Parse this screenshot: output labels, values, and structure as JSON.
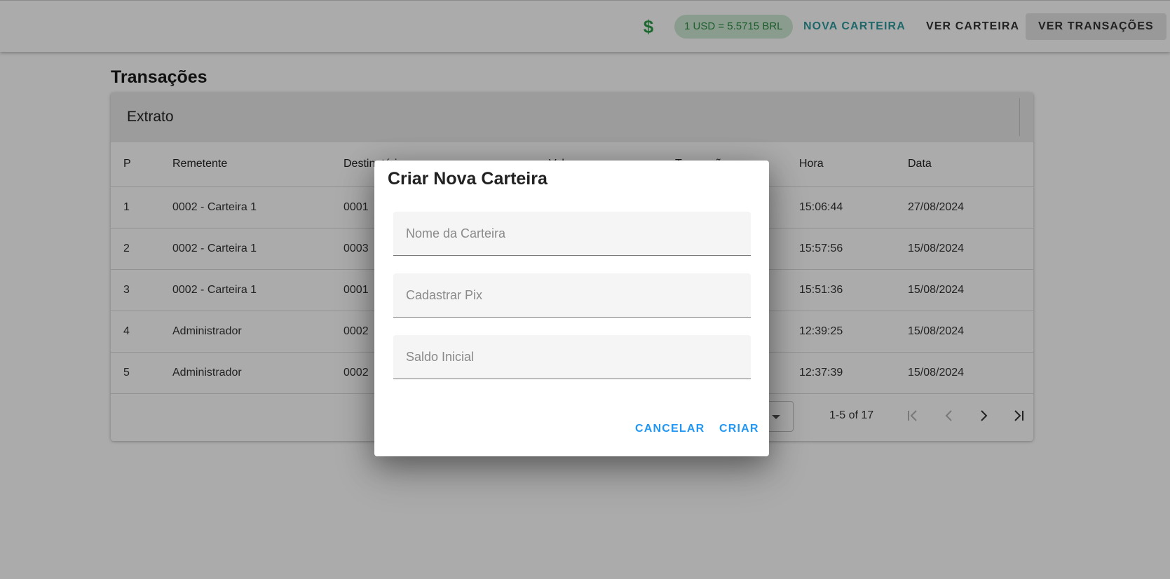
{
  "appbar": {
    "currency_icon": "dollar-icon",
    "exchange_rate": "1 USD = 5.5715 BRL",
    "nav": {
      "new_wallet": "NOVA CARTEIRA",
      "view_wallet": "VER CARTEIRA",
      "view_transactions": "VER TRANSAÇÕES"
    }
  },
  "page": {
    "title": "Transações",
    "card_title": "Extrato",
    "table": {
      "headers": [
        "P",
        "Remetente",
        "Destinatário",
        "Valor",
        "Transação",
        "Hora",
        "Data"
      ],
      "rows": [
        {
          "p": "1",
          "sender": "0002 - Carteira 1",
          "receiver": "0001",
          "hora": "15:06:44",
          "data": "27/08/2024"
        },
        {
          "p": "2",
          "sender": "0002 - Carteira 1",
          "receiver": "0003",
          "hora": "15:57:56",
          "data": "15/08/2024"
        },
        {
          "p": "3",
          "sender": "0002 - Carteira 1",
          "receiver": "0001",
          "hora": "15:51:36",
          "data": "15/08/2024"
        },
        {
          "p": "4",
          "sender": "Administrador",
          "receiver": "0002",
          "hora": "12:39:25",
          "data": "15/08/2024"
        },
        {
          "p": "5",
          "sender": "Administrador",
          "receiver": "0002",
          "hora": "12:37:39",
          "data": "15/08/2024"
        }
      ]
    },
    "pagination": {
      "range": "1-5 of 17",
      "icons": [
        "first-page-icon",
        "previous-page-icon",
        "next-page-icon",
        "last-page-icon"
      ]
    }
  },
  "dialog": {
    "title": "Criar Nova Carteira",
    "fields": {
      "name": {
        "placeholder": "Nome da Carteira",
        "value": ""
      },
      "pix": {
        "placeholder": "Cadastrar Pix",
        "value": ""
      },
      "balance": {
        "placeholder": "Saldo Inicial",
        "value": ""
      }
    },
    "actions": {
      "cancel": "CANCELAR",
      "create": "CRIAR"
    }
  },
  "colors": {
    "accent": "#2196f3",
    "nav_active_text": "#2f9a9d",
    "chip_bg": "#cde9d2",
    "chip_text": "#2e8b45"
  }
}
